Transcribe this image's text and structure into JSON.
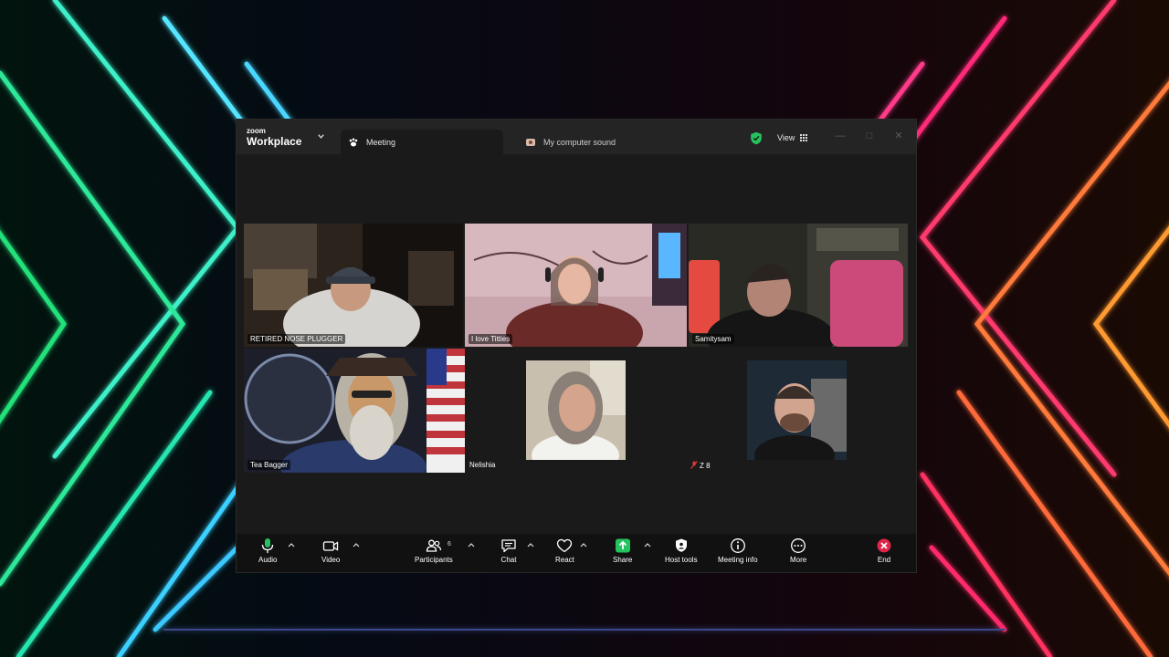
{
  "app": {
    "logo_small": "zoom",
    "logo_big": "Workplace"
  },
  "tabs": [
    {
      "label": "Meeting",
      "icon": "paw-icon",
      "active": true
    },
    {
      "label": "My computer sound",
      "icon": "sound-share-icon",
      "active": false
    }
  ],
  "header": {
    "view_label": "View",
    "shield_icon": "security-shield-icon",
    "shield_color": "#27c25f"
  },
  "participants": [
    {
      "name": "RETIRED NOSE PLUGGER",
      "video": true,
      "speaking": false
    },
    {
      "name": "I love Titties",
      "video": true,
      "speaking": true
    },
    {
      "name": "Samitysam",
      "video": true,
      "speaking": false
    },
    {
      "name": "Tea Bagger",
      "video": true,
      "speaking": false
    },
    {
      "name": "Nelishia",
      "video": true,
      "speaking": false
    },
    {
      "name": "Z 8",
      "video": true,
      "speaking": false,
      "muted": true
    }
  ],
  "toolbar": {
    "audio": "Audio",
    "video": "Video",
    "participants": "Participants",
    "participant_count": "6",
    "chat": "Chat",
    "react": "React",
    "share": "Share",
    "host_tools": "Host tools",
    "meeting_info": "Meeting info",
    "more": "More",
    "end": "End"
  },
  "colors": {
    "speaking_border": "#32d26e",
    "share_green": "#23c45e",
    "end_red": "#e0254a",
    "mic_green": "#27c25f"
  }
}
